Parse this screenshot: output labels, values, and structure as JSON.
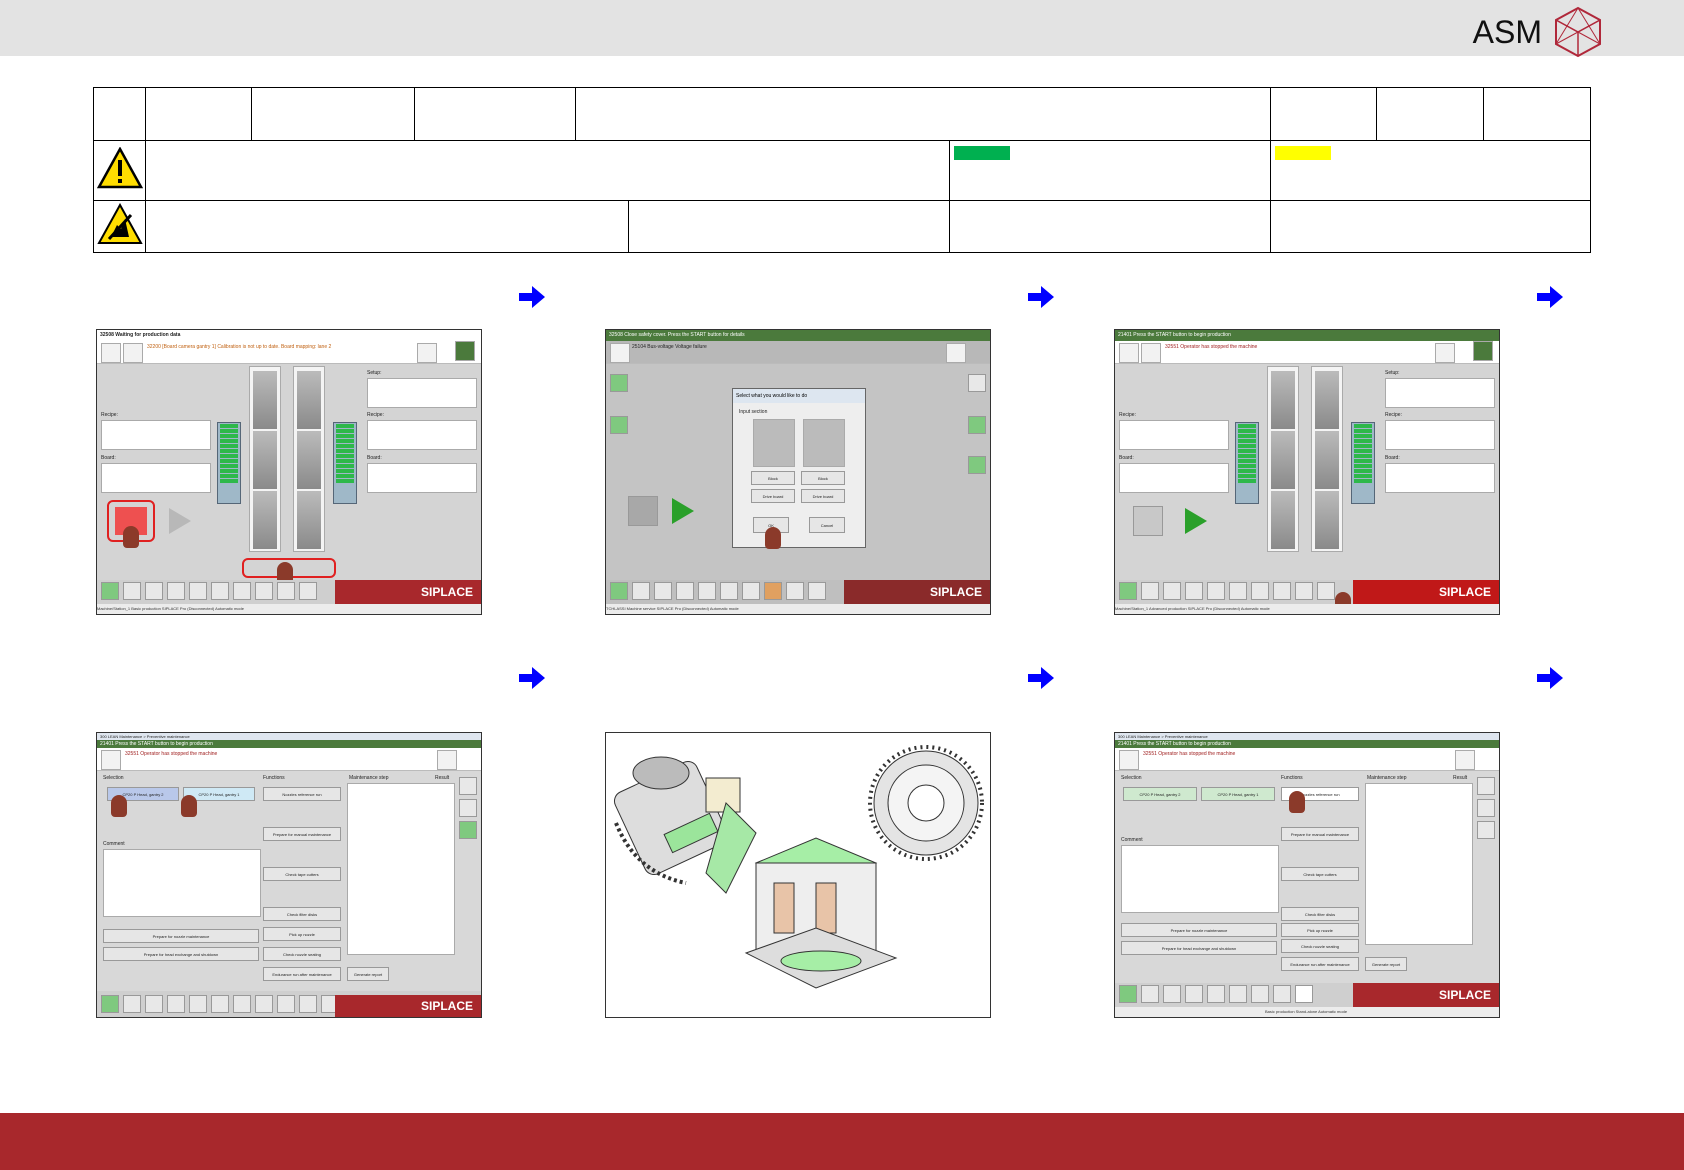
{
  "brand": {
    "name": "ASM"
  },
  "colors": {
    "footer": "#a8282c",
    "topbar": "#e3e3e3",
    "arrow": "#0000ff",
    "green_swatch": "#00b050",
    "yellow_swatch": "#ffff00"
  },
  "screens": {
    "s1": {
      "title": "32508 Waiting for production data",
      "message": "32200 [Board camera gantry 1] Calibration is not up to date. Board mapping: lane 2",
      "recipe_label": "Recipe:",
      "board_label": "Board:",
      "setup_label": "Setup:",
      "recipe2_label": "Recipe:",
      "board2_label": "Board:",
      "brand": "SIPLACE",
      "status": "Machine/Station_1    Basic production    SIPLACE Pro (Disconnected)    Automatic mode"
    },
    "s2": {
      "title": "32508 Close safety cover. Press the START button for details",
      "message": "25104 Bus-voltage Voltage failure",
      "dialog_title": "Select what you would like to do",
      "dialog_section": "Input section",
      "opt_block1": "Block",
      "opt_block2": "Block",
      "opt_drive1": "Drive board",
      "opt_drive2": "Drive board",
      "ok": "OK",
      "cancel": "Cancel",
      "brand": "SIPLACE",
      "status": "TCHLASSI    Machine service    SIPLACE Pro (Disconnected)    Automatic mode"
    },
    "s3": {
      "title": "21401 Press the START button to begin production",
      "message": "32551 Operator has stopped the machine",
      "recipe_label": "Recipe:",
      "board_label": "Board:",
      "setup_label": "Setup:",
      "recipe2_label": "Recipe:",
      "board2_label": "Board:",
      "brand": "SIPLACE",
      "status": "Machine/Station_1    Advanced production    SIPLACE Pro (Disconnected)    Automatic mode"
    },
    "s4": {
      "title": "21401 Press the START button to begin production",
      "window": "300 LEAN Maintenance > Preventive maintenance",
      "message": "32551 Operator has stopped the machine",
      "selection_label": "Selection",
      "functions_label": "Functions",
      "maint_label": "Maintenance step",
      "result_label": "Result",
      "comment_label": "Comment",
      "head1": "CP20 P Head, gantry 2",
      "head2": "CP20 P Head, gantry 1",
      "f1": "Nozzles reference run",
      "f2": "Prepare for manual maintenance",
      "f3": "Check tape cutters",
      "f4": "Check filter disks",
      "f5": "Pick up nozzle",
      "f6": "Check nozzle seating",
      "f7": "Endurance run after maintenance",
      "f8": "Generate report",
      "b1": "Prepare for nozzle maintenance",
      "b2": "Prepare for head exchange and shutdown",
      "brand": "SIPLACE"
    },
    "s6": {
      "title": "21401 Press the START button to begin production",
      "window": "300 LEAN Maintenance > Preventive maintenance",
      "message": "32551 Operator has stopped the machine",
      "selection_label": "Selection",
      "functions_label": "Functions",
      "maint_label": "Maintenance step",
      "result_label": "Result",
      "comment_label": "Comment",
      "head1": "CP20 P Head, gantry 2",
      "head2": "CP20 P Head, gantry 1",
      "f1": "Nozzles reference run",
      "f2": "Prepare for manual maintenance",
      "f3": "Check tape cutters",
      "f4": "Check filter disks",
      "f5": "Pick up nozzle",
      "f6": "Check nozzle seating",
      "f7": "Endurance run after maintenance",
      "f8": "Generate report",
      "b1": "Prepare for nozzle maintenance",
      "b2": "Prepare for head exchange and shutdown",
      "brand": "SIPLACE",
      "status": "Basic production    Stand-alone    Automatic mode"
    }
  }
}
